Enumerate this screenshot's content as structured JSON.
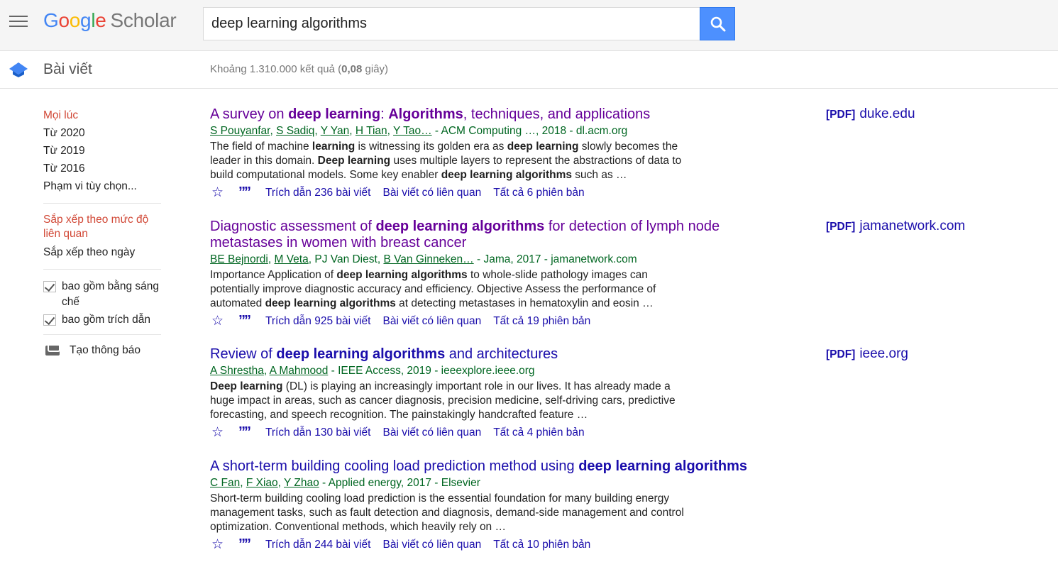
{
  "header": {
    "logo_letters": [
      "G",
      "o",
      "o",
      "g",
      "l",
      "e"
    ],
    "logo_product": "Scholar",
    "search_value": "deep learning algorithms"
  },
  "subbar": {
    "section_title": "Bài viết",
    "stats_prefix": "Khoảng 1.310.000 kết quả (",
    "stats_time": "0,08",
    "stats_suffix": " giây)"
  },
  "sidebar": {
    "time_filters": [
      "Mọi lúc",
      "Từ 2020",
      "Từ 2019",
      "Từ 2016",
      "Phạm vi tùy chọn..."
    ],
    "sort_relevance": "Sắp xếp theo mức độ liên quan",
    "sort_date": "Sắp xếp theo ngày",
    "include_patents": "bao gồm bằng sáng chế",
    "include_citations": "bao gồm trích dẫn",
    "create_alert": "Tạo thông báo"
  },
  "results": [
    {
      "title_parts": [
        {
          "t": "A survey on ",
          "b": false
        },
        {
          "t": "deep learning",
          "b": true
        },
        {
          "t": ": ",
          "b": false
        },
        {
          "t": "Algorithms",
          "b": true
        },
        {
          "t": ", techniques, and applications",
          "b": false
        }
      ],
      "visited": true,
      "authors": [
        "S Pouyanfar",
        "S Sadiq",
        "Y Yan",
        "H Tian",
        "Y Tao…"
      ],
      "source": " - ACM Computing …, 2018 - dl.acm.org",
      "snippet_parts": [
        {
          "t": "The field of machine ",
          "b": false
        },
        {
          "t": "learning",
          "b": true
        },
        {
          "t": " is witnessing its golden era as ",
          "b": false
        },
        {
          "t": "deep learning",
          "b": true
        },
        {
          "t": " slowly becomes the leader in this domain. ",
          "b": false
        },
        {
          "t": "Deep learning",
          "b": true
        },
        {
          "t": " uses multiple layers to represent the abstractions of data to build computational models. Some key enabler ",
          "b": false
        },
        {
          "t": "deep learning algorithms",
          "b": true
        },
        {
          "t": " such as …",
          "b": false
        }
      ],
      "cited": "Trích dẫn 236 bài viết",
      "related": "Bài viết có liên quan",
      "versions": "Tất cả 6 phiên bản",
      "pdf_tag": "[PDF]",
      "pdf_domain": "duke.edu"
    },
    {
      "title_parts": [
        {
          "t": "Diagnostic assessment of ",
          "b": false
        },
        {
          "t": "deep learning algorithms",
          "b": true
        },
        {
          "t": " for detection of lymph node metastases in women with breast cancer",
          "b": false
        }
      ],
      "visited": true,
      "authors": [
        "BE Bejnordi",
        "M Veta",
        "B Van Ginneken…"
      ],
      "authors_plain": "PJ Van Diest",
      "source": " - Jama, 2017 - jamanetwork.com",
      "snippet_parts": [
        {
          "t": "Importance Application of ",
          "b": false
        },
        {
          "t": "deep learning algorithms",
          "b": true
        },
        {
          "t": " to whole-slide pathology images can potentially improve diagnostic accuracy and efficiency. Objective Assess the performance of automated ",
          "b": false
        },
        {
          "t": "deep learning algorithms",
          "b": true
        },
        {
          "t": " at detecting metastases in hematoxylin and eosin …",
          "b": false
        }
      ],
      "cited": "Trích dẫn 925 bài viết",
      "related": "Bài viết có liên quan",
      "versions": "Tất cả 19 phiên bản",
      "pdf_tag": "[PDF]",
      "pdf_domain": "jamanetwork.com"
    },
    {
      "title_parts": [
        {
          "t": "Review of ",
          "b": false
        },
        {
          "t": "deep learning algorithms",
          "b": true
        },
        {
          "t": " and architectures",
          "b": false
        }
      ],
      "visited": false,
      "authors": [
        "A Shrestha",
        "A Mahmood"
      ],
      "source": " - IEEE Access, 2019 - ieeexplore.ieee.org",
      "snippet_parts": [
        {
          "t": "Deep learning",
          "b": true
        },
        {
          "t": " (DL) is playing an increasingly important role in our lives. It has already made a huge impact in areas, such as cancer diagnosis, precision medicine, self-driving cars, predictive forecasting, and speech recognition. The painstakingly handcrafted feature …",
          "b": false
        }
      ],
      "cited": "Trích dẫn 130 bài viết",
      "related": "Bài viết có liên quan",
      "versions": "Tất cả 4 phiên bản",
      "pdf_tag": "[PDF]",
      "pdf_domain": "ieee.org"
    },
    {
      "title_parts": [
        {
          "t": "A short-term building cooling load prediction method using ",
          "b": false
        },
        {
          "t": "deep learning algorithms",
          "b": true
        }
      ],
      "visited": false,
      "authors": [
        "C Fan",
        "F Xiao",
        "Y Zhao"
      ],
      "source": " - Applied energy, 2017 - Elsevier",
      "snippet_parts": [
        {
          "t": "Short-term building cooling load prediction is the essential foundation for many building energy management tasks, such as fault detection and diagnosis, demand-side management and control optimization. Conventional methods, which heavily rely on …",
          "b": false
        }
      ],
      "cited": "Trích dẫn 244 bài viết",
      "related": "Bài viết có liên quan",
      "versions": "Tất cả 10 phiên bản",
      "pdf_tag": "",
      "pdf_domain": ""
    }
  ],
  "icons": {
    "menu": "hamburger-icon",
    "search": "magnifier-icon",
    "articles": "graduation-cap-icon",
    "star": "star-icon",
    "cite": "quote-icon",
    "alert": "envelope-icon"
  },
  "colors": {
    "link": "#1a0dab",
    "visited": "#660099",
    "green": "#006621",
    "active_filter": "#d14836",
    "search_button": "#4d90fe"
  }
}
